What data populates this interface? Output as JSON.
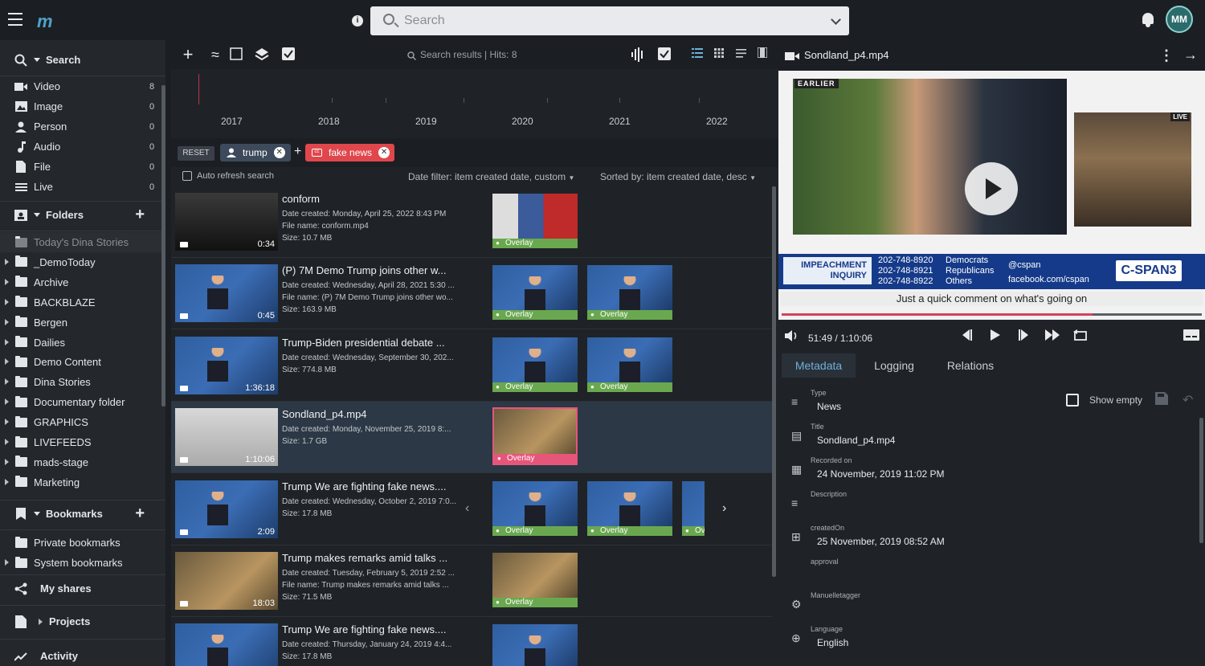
{
  "topbar": {
    "search_placeholder": "Search"
  },
  "user": {
    "initials": "MM"
  },
  "sidebar": {
    "search_label": "Search",
    "types": [
      {
        "label": "Video",
        "count": "8"
      },
      {
        "label": "Image",
        "count": "0"
      },
      {
        "label": "Person",
        "count": "0"
      },
      {
        "label": "Audio",
        "count": "0"
      },
      {
        "label": "File",
        "count": "0"
      },
      {
        "label": "Live",
        "count": "0"
      }
    ],
    "folders_label": "Folders",
    "folders": [
      "Today's Dina Stories",
      "_DemoToday",
      "Archive",
      "BACKBLAZE",
      "Bergen",
      "Dailies",
      "Demo Content",
      "Dina Stories",
      "Documentary folder",
      "GRAPHICS",
      "LIVEFEEDS",
      "mads-stage",
      "Marketing"
    ],
    "bookmarks_label": "Bookmarks",
    "bookmarks": [
      "Private bookmarks",
      "System bookmarks"
    ],
    "my_shares": "My shares",
    "projects": "Projects",
    "activity": "Activity"
  },
  "middle": {
    "search_results": "Search results | Hits: 8",
    "years": [
      "2017",
      "2018",
      "2019",
      "2020",
      "2021",
      "2022"
    ],
    "reset": "RESET",
    "chips": [
      "trump",
      "fake news"
    ],
    "auto_refresh": "Auto refresh search",
    "date_filter": "Date filter: item created date, custom",
    "sorted_by": "Sorted by: item created date, desc",
    "overlay_label": "Overlay",
    "results": [
      {
        "title": "conform",
        "meta": [
          "Date created: Monday, April 25, 2022 8:43 PM",
          "File name: conform.mp4",
          "Size: 10.7 MB"
        ],
        "duration": "0:34"
      },
      {
        "title": "(P) 7M Demo Trump joins other w...",
        "meta": [
          "Date created: Wednesday, April 28, 2021 5:30 ...",
          "File name: (P) 7M Demo Trump joins other wo...",
          "Size: 163.9 MB"
        ],
        "duration": "0:45"
      },
      {
        "title": "Trump-Biden presidential debate ...",
        "meta": [
          "Date created: Wednesday, September 30, 202...",
          "Size: 774.8 MB"
        ],
        "duration": "1:36:18"
      },
      {
        "title": "Sondland_p4.mp4",
        "meta": [
          "Date created: Monday, November 25, 2019 8:...",
          "Size: 1.7 GB"
        ],
        "duration": "1:10:06"
      },
      {
        "title": "Trump We are fighting fake news....",
        "meta": [
          "Date created: Wednesday, October 2, 2019 7:0...",
          "Size: 17.8 MB"
        ],
        "duration": "2:09"
      },
      {
        "title": "Trump makes remarks amid talks ...",
        "meta": [
          "Date created: Tuesday, February 5, 2019 2:52 ...",
          "File name: Trump makes remarks amid talks ...",
          "Size: 71.5 MB"
        ],
        "duration": "18:03"
      },
      {
        "title": "Trump We are fighting fake news....",
        "meta": [
          "Date created: Thursday, January 24, 2019 4:4...",
          "Size: 17.8 MB"
        ],
        "duration": ""
      }
    ]
  },
  "player": {
    "title": "Sondland_p4.mp4",
    "earlier": "EARLIER",
    "live": "LIVE",
    "lower_third": {
      "inquiry_line1": "IMPEACHMENT",
      "inquiry_line2": "INQUIRY",
      "phones": [
        "202-748-8920",
        "202-748-8921",
        "202-748-8922"
      ],
      "parties": [
        "Democrats",
        "Republicans",
        "Others"
      ],
      "social": [
        "@cspan",
        "facebook.com/cspan"
      ],
      "network": "C-SPAN3"
    },
    "ticker": "Just a quick comment on what's going on",
    "time": "51:49 / 1:10:06",
    "progress": 0.74
  },
  "metadata": {
    "tabs": [
      "Metadata",
      "Logging",
      "Relations"
    ],
    "show_empty": "Show empty",
    "fields": [
      {
        "key": "Type",
        "value": "News"
      },
      {
        "key": "Title",
        "value": "Sondland_p4.mp4"
      },
      {
        "key": "Recorded on",
        "value": "24 November, 2019 11:02 PM"
      },
      {
        "key": "Description",
        "value": ""
      },
      {
        "key": "createdOn",
        "value": "25 November, 2019 08:52 AM"
      },
      {
        "key": "approval",
        "value": ""
      },
      {
        "key": "Manuelletagger",
        "value": ""
      },
      {
        "key": "Language",
        "value": "English"
      }
    ]
  }
}
